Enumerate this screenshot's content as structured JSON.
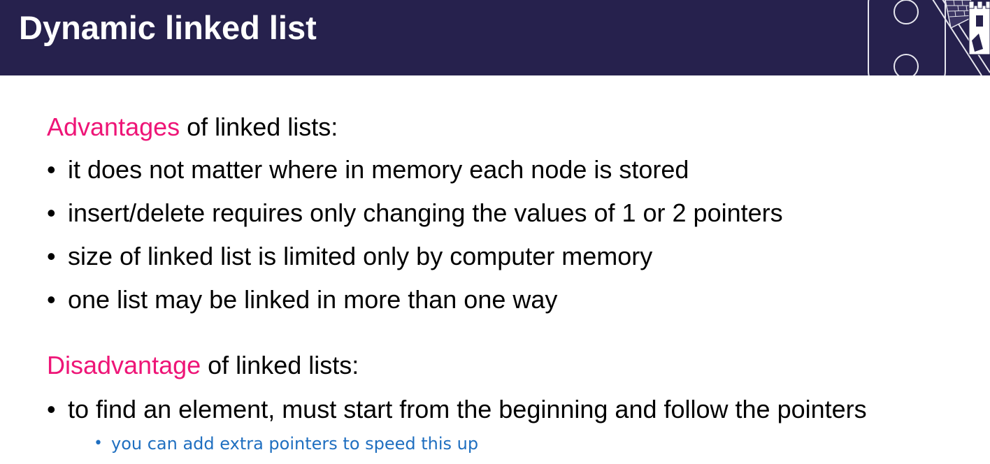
{
  "header": {
    "title": "Dynamic linked list",
    "background_color": "#26214d",
    "corner_decoration": "castle-logo-icon"
  },
  "advantages": {
    "heading_accent": "Advantages",
    "heading_rest": " of linked lists:",
    "items": [
      "it does not matter where in memory each node is stored",
      "insert/delete requires only changing the values of 1 or 2 pointers",
      "size of linked list is limited only by computer memory",
      "one list may be linked in more than one way"
    ]
  },
  "disadvantages": {
    "heading_accent": "Disadvantage",
    "heading_rest": " of linked lists:",
    "items": [
      "to find an element, must start from the beginning and follow the pointers"
    ],
    "sub_items": [
      "you can add extra pointers to speed this up"
    ]
  },
  "style": {
    "accent_color": "#ee1577",
    "sub_bullet_color": "#1f6fc0",
    "bullet_glyph": "•"
  }
}
